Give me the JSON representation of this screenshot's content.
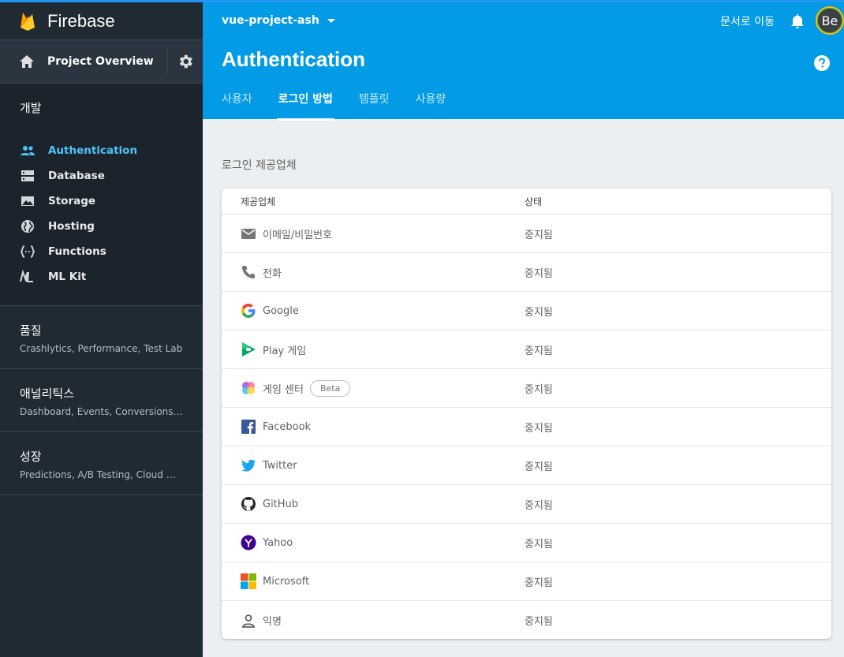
{
  "sidebar": {
    "brand": "Firebase",
    "overview": "Project Overview",
    "dev_title": "개발",
    "dev_items": [
      {
        "label": "Authentication",
        "icon": "people-icon",
        "active": true
      },
      {
        "label": "Database",
        "icon": "database-icon"
      },
      {
        "label": "Storage",
        "icon": "image-icon"
      },
      {
        "label": "Hosting",
        "icon": "globe-icon"
      },
      {
        "label": "Functions",
        "icon": "functions-icon"
      },
      {
        "label": "ML Kit",
        "icon": "ml-kit-icon"
      }
    ],
    "groups": [
      {
        "title": "품질",
        "subtitle": "Crashlytics, Performance, Test Lab"
      },
      {
        "title": "애널리틱스",
        "subtitle": "Dashboard, Events, Conversions, Au..."
      },
      {
        "title": "성장",
        "subtitle": "Predictions, A/B Testing, Cloud Mes..."
      }
    ]
  },
  "header": {
    "project": "vue-project-ash",
    "docs_link": "문서로 이동",
    "avatar": "Be",
    "title": "Authentication",
    "tabs": [
      "사용자",
      "로그인 방법",
      "템플릿",
      "사용량"
    ],
    "active_tab": 1
  },
  "main": {
    "section_label": "로그인 제공업체",
    "columns": [
      "제공업체",
      "상태"
    ],
    "providers": [
      {
        "name": "이메일/비밀번호",
        "status": "중지됨",
        "icon": "email-icon"
      },
      {
        "name": "전화",
        "status": "중지됨",
        "icon": "phone-icon"
      },
      {
        "name": "Google",
        "status": "중지됨",
        "icon": "google-icon"
      },
      {
        "name": "Play 게임",
        "status": "중지됨",
        "icon": "play-games-icon"
      },
      {
        "name": "게임 센터",
        "status": "중지됨",
        "icon": "game-center-icon",
        "badge": "Beta"
      },
      {
        "name": "Facebook",
        "status": "중지됨",
        "icon": "facebook-icon"
      },
      {
        "name": "Twitter",
        "status": "중지됨",
        "icon": "twitter-icon"
      },
      {
        "name": "GitHub",
        "status": "중지됨",
        "icon": "github-icon"
      },
      {
        "name": "Yahoo",
        "status": "중지됨",
        "icon": "yahoo-icon"
      },
      {
        "name": "Microsoft",
        "status": "중지됨",
        "icon": "microsoft-icon"
      },
      {
        "name": "익명",
        "status": "중지됨",
        "icon": "anonymous-icon"
      }
    ]
  },
  "colors": {
    "header_bg": "#039be5",
    "sidebar_bg": "#202a33",
    "active_nav": "#4fc3f7"
  }
}
